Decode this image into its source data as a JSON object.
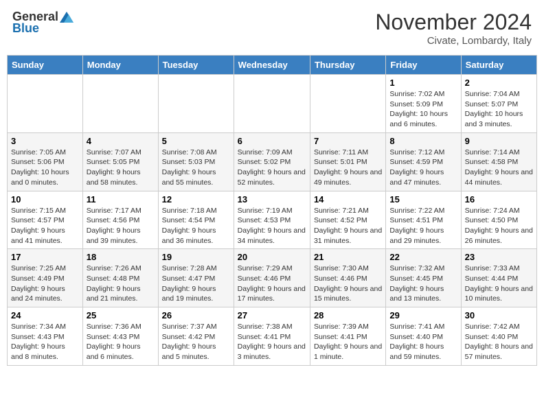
{
  "header": {
    "logo_general": "General",
    "logo_blue": "Blue",
    "month_title": "November 2024",
    "subtitle": "Civate, Lombardy, Italy"
  },
  "days_of_week": [
    "Sunday",
    "Monday",
    "Tuesday",
    "Wednesday",
    "Thursday",
    "Friday",
    "Saturday"
  ],
  "weeks": [
    [
      {
        "day": "",
        "info": ""
      },
      {
        "day": "",
        "info": ""
      },
      {
        "day": "",
        "info": ""
      },
      {
        "day": "",
        "info": ""
      },
      {
        "day": "",
        "info": ""
      },
      {
        "day": "1",
        "info": "Sunrise: 7:02 AM\nSunset: 5:09 PM\nDaylight: 10 hours and 6 minutes."
      },
      {
        "day": "2",
        "info": "Sunrise: 7:04 AM\nSunset: 5:07 PM\nDaylight: 10 hours and 3 minutes."
      }
    ],
    [
      {
        "day": "3",
        "info": "Sunrise: 7:05 AM\nSunset: 5:06 PM\nDaylight: 10 hours and 0 minutes."
      },
      {
        "day": "4",
        "info": "Sunrise: 7:07 AM\nSunset: 5:05 PM\nDaylight: 9 hours and 58 minutes."
      },
      {
        "day": "5",
        "info": "Sunrise: 7:08 AM\nSunset: 5:03 PM\nDaylight: 9 hours and 55 minutes."
      },
      {
        "day": "6",
        "info": "Sunrise: 7:09 AM\nSunset: 5:02 PM\nDaylight: 9 hours and 52 minutes."
      },
      {
        "day": "7",
        "info": "Sunrise: 7:11 AM\nSunset: 5:01 PM\nDaylight: 9 hours and 49 minutes."
      },
      {
        "day": "8",
        "info": "Sunrise: 7:12 AM\nSunset: 4:59 PM\nDaylight: 9 hours and 47 minutes."
      },
      {
        "day": "9",
        "info": "Sunrise: 7:14 AM\nSunset: 4:58 PM\nDaylight: 9 hours and 44 minutes."
      }
    ],
    [
      {
        "day": "10",
        "info": "Sunrise: 7:15 AM\nSunset: 4:57 PM\nDaylight: 9 hours and 41 minutes."
      },
      {
        "day": "11",
        "info": "Sunrise: 7:17 AM\nSunset: 4:56 PM\nDaylight: 9 hours and 39 minutes."
      },
      {
        "day": "12",
        "info": "Sunrise: 7:18 AM\nSunset: 4:54 PM\nDaylight: 9 hours and 36 minutes."
      },
      {
        "day": "13",
        "info": "Sunrise: 7:19 AM\nSunset: 4:53 PM\nDaylight: 9 hours and 34 minutes."
      },
      {
        "day": "14",
        "info": "Sunrise: 7:21 AM\nSunset: 4:52 PM\nDaylight: 9 hours and 31 minutes."
      },
      {
        "day": "15",
        "info": "Sunrise: 7:22 AM\nSunset: 4:51 PM\nDaylight: 9 hours and 29 minutes."
      },
      {
        "day": "16",
        "info": "Sunrise: 7:24 AM\nSunset: 4:50 PM\nDaylight: 9 hours and 26 minutes."
      }
    ],
    [
      {
        "day": "17",
        "info": "Sunrise: 7:25 AM\nSunset: 4:49 PM\nDaylight: 9 hours and 24 minutes."
      },
      {
        "day": "18",
        "info": "Sunrise: 7:26 AM\nSunset: 4:48 PM\nDaylight: 9 hours and 21 minutes."
      },
      {
        "day": "19",
        "info": "Sunrise: 7:28 AM\nSunset: 4:47 PM\nDaylight: 9 hours and 19 minutes."
      },
      {
        "day": "20",
        "info": "Sunrise: 7:29 AM\nSunset: 4:46 PM\nDaylight: 9 hours and 17 minutes."
      },
      {
        "day": "21",
        "info": "Sunrise: 7:30 AM\nSunset: 4:46 PM\nDaylight: 9 hours and 15 minutes."
      },
      {
        "day": "22",
        "info": "Sunrise: 7:32 AM\nSunset: 4:45 PM\nDaylight: 9 hours and 13 minutes."
      },
      {
        "day": "23",
        "info": "Sunrise: 7:33 AM\nSunset: 4:44 PM\nDaylight: 9 hours and 10 minutes."
      }
    ],
    [
      {
        "day": "24",
        "info": "Sunrise: 7:34 AM\nSunset: 4:43 PM\nDaylight: 9 hours and 8 minutes."
      },
      {
        "day": "25",
        "info": "Sunrise: 7:36 AM\nSunset: 4:43 PM\nDaylight: 9 hours and 6 minutes."
      },
      {
        "day": "26",
        "info": "Sunrise: 7:37 AM\nSunset: 4:42 PM\nDaylight: 9 hours and 5 minutes."
      },
      {
        "day": "27",
        "info": "Sunrise: 7:38 AM\nSunset: 4:41 PM\nDaylight: 9 hours and 3 minutes."
      },
      {
        "day": "28",
        "info": "Sunrise: 7:39 AM\nSunset: 4:41 PM\nDaylight: 9 hours and 1 minute."
      },
      {
        "day": "29",
        "info": "Sunrise: 7:41 AM\nSunset: 4:40 PM\nDaylight: 8 hours and 59 minutes."
      },
      {
        "day": "30",
        "info": "Sunrise: 7:42 AM\nSunset: 4:40 PM\nDaylight: 8 hours and 57 minutes."
      }
    ]
  ]
}
